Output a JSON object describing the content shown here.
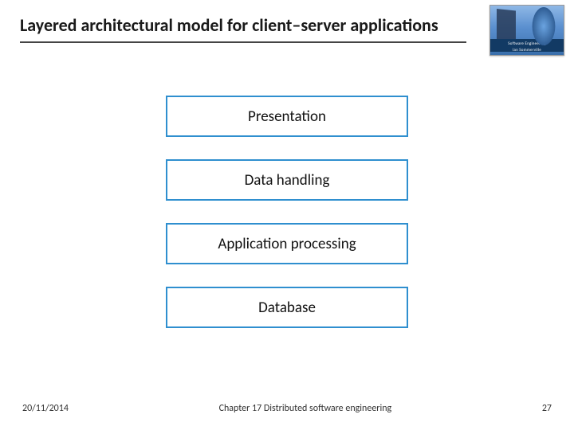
{
  "header": {
    "title": "Layered architectural model for client–server applications",
    "cover_text_top": "Software Engineering",
    "cover_text_bottom": "Ian Sommerville"
  },
  "layers": [
    {
      "label": "Presentation"
    },
    {
      "label": "Data handling"
    },
    {
      "label": "Application processing"
    },
    {
      "label": "Database"
    }
  ],
  "footer": {
    "date": "20/11/2014",
    "chapter": "Chapter 17 Distributed software engineering",
    "page": "27"
  }
}
